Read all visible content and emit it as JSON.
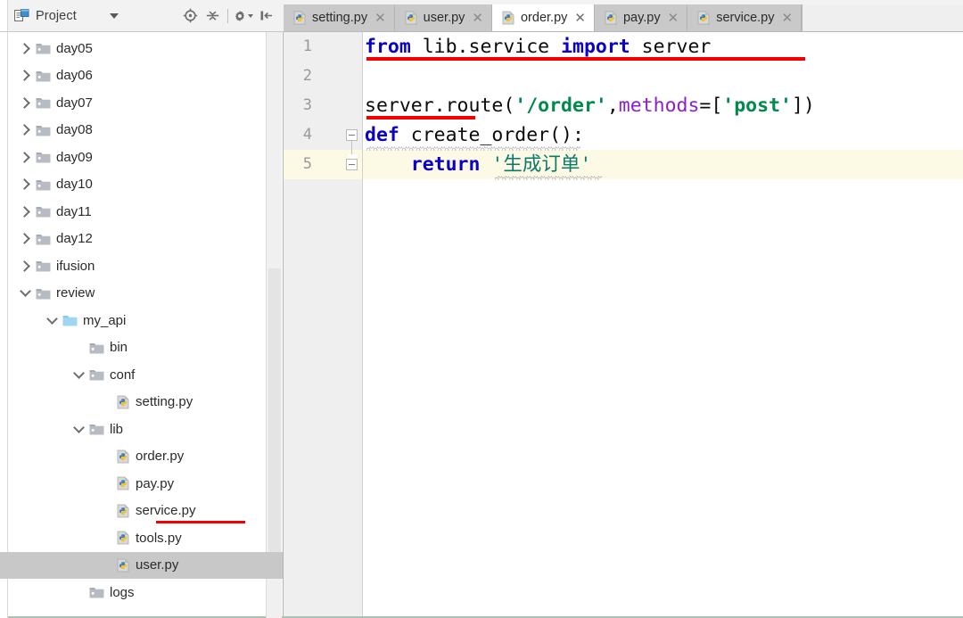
{
  "window": {
    "accent_red": "#f50000",
    "selection_gray": "#c8c8c8",
    "current_line": "#fcf9e4"
  },
  "project_panel": {
    "title": "Project",
    "title_icon": "project-panel-icon",
    "dropdown_icon": "chevron-down-icon",
    "toolbar": [
      {
        "name": "locate-file-icon",
        "label": "Select Opened File"
      },
      {
        "name": "collapse-all-icon",
        "label": "Collapse All"
      },
      {
        "name": "gear-icon",
        "label": "Settings"
      },
      {
        "name": "hide-panel-icon",
        "label": "Hide"
      }
    ]
  },
  "editor_tabs": [
    {
      "label": "setting.py",
      "icon": "python-file-icon",
      "active": false,
      "close_icon": "close-icon"
    },
    {
      "label": "user.py",
      "icon": "python-file-icon",
      "active": false,
      "close_icon": "close-icon"
    },
    {
      "label": "order.py",
      "icon": "python-file-icon",
      "active": true,
      "close_icon": "close-icon"
    },
    {
      "label": "pay.py",
      "icon": "python-file-icon",
      "active": false,
      "close_icon": "close-icon"
    },
    {
      "label": "service.py",
      "icon": "python-file-icon",
      "active": false,
      "close_icon": "close-icon"
    }
  ],
  "project_tree": [
    {
      "label": "day05",
      "type": "folder",
      "indent": 0,
      "arrow": "right",
      "selected": false,
      "underlined": false
    },
    {
      "label": "day06",
      "type": "folder",
      "indent": 0,
      "arrow": "right",
      "selected": false,
      "underlined": false
    },
    {
      "label": "day07",
      "type": "folder",
      "indent": 0,
      "arrow": "right",
      "selected": false,
      "underlined": false
    },
    {
      "label": "day08",
      "type": "folder",
      "indent": 0,
      "arrow": "right",
      "selected": false,
      "underlined": false
    },
    {
      "label": "day09",
      "type": "folder",
      "indent": 0,
      "arrow": "right",
      "selected": false,
      "underlined": false
    },
    {
      "label": "day10",
      "type": "folder",
      "indent": 0,
      "arrow": "right",
      "selected": false,
      "underlined": false
    },
    {
      "label": "day11",
      "type": "folder",
      "indent": 0,
      "arrow": "right",
      "selected": false,
      "underlined": false
    },
    {
      "label": "day12",
      "type": "folder",
      "indent": 0,
      "arrow": "right",
      "selected": false,
      "underlined": false
    },
    {
      "label": "ifusion",
      "type": "folder",
      "indent": 0,
      "arrow": "right",
      "selected": false,
      "underlined": false
    },
    {
      "label": "review",
      "type": "folder",
      "indent": 0,
      "arrow": "down",
      "selected": false,
      "underlined": false
    },
    {
      "label": "my_api",
      "type": "source-root",
      "indent": 1,
      "arrow": "down",
      "selected": false,
      "underlined": false
    },
    {
      "label": "bin",
      "type": "folder",
      "indent": 2,
      "arrow": "none",
      "selected": false,
      "underlined": false
    },
    {
      "label": "conf",
      "type": "folder",
      "indent": 2,
      "arrow": "down",
      "selected": false,
      "underlined": false
    },
    {
      "label": "setting.py",
      "type": "python",
      "indent": 3,
      "arrow": "none",
      "selected": false,
      "underlined": false
    },
    {
      "label": "lib",
      "type": "folder",
      "indent": 2,
      "arrow": "down",
      "selected": false,
      "underlined": false
    },
    {
      "label": "order.py",
      "type": "python",
      "indent": 3,
      "arrow": "none",
      "selected": false,
      "underlined": false
    },
    {
      "label": "pay.py",
      "type": "python",
      "indent": 3,
      "arrow": "none",
      "selected": false,
      "underlined": false
    },
    {
      "label": "service.py",
      "type": "python",
      "indent": 3,
      "arrow": "none",
      "selected": false,
      "underlined": true
    },
    {
      "label": "tools.py",
      "type": "python",
      "indent": 3,
      "arrow": "none",
      "selected": false,
      "underlined": false
    },
    {
      "label": "user.py",
      "type": "python",
      "indent": 3,
      "arrow": "none",
      "selected": true,
      "underlined": false
    },
    {
      "label": "logs",
      "type": "folder",
      "indent": 2,
      "arrow": "none",
      "selected": false,
      "underlined": false
    }
  ],
  "code": {
    "file": "order.py",
    "line_numbers": [
      "1",
      "2",
      "3",
      "4",
      "5"
    ],
    "current_line": 5,
    "lines": [
      {
        "n": 1,
        "text": "from lib.service import server"
      },
      {
        "n": 2,
        "text": ""
      },
      {
        "n": 3,
        "text": "server.route('/order',methods=['post'])"
      },
      {
        "n": 4,
        "text": "def create_order():"
      },
      {
        "n": 5,
        "text": "    return '生成订单'"
      }
    ],
    "tokens": {
      "l1_from": "from",
      "l1_module": " lib.service ",
      "l1_import": "import",
      "l1_server": " server",
      "l3_call": "server.route(",
      "l3_route": "'/order'",
      "l3_comma": ",",
      "l3_methods": "methods",
      "l3_eq_open": "=[",
      "l3_post": "'post'",
      "l3_close": "])",
      "l4_def": "def",
      "l4_name": " create_order():",
      "l5_return": "return",
      "l5_value": " '生成订单'"
    },
    "annotations": [
      {
        "name": "red-underline-import-line",
        "line": 1
      },
      {
        "name": "red-underline-server-route",
        "line": 3
      }
    ]
  }
}
